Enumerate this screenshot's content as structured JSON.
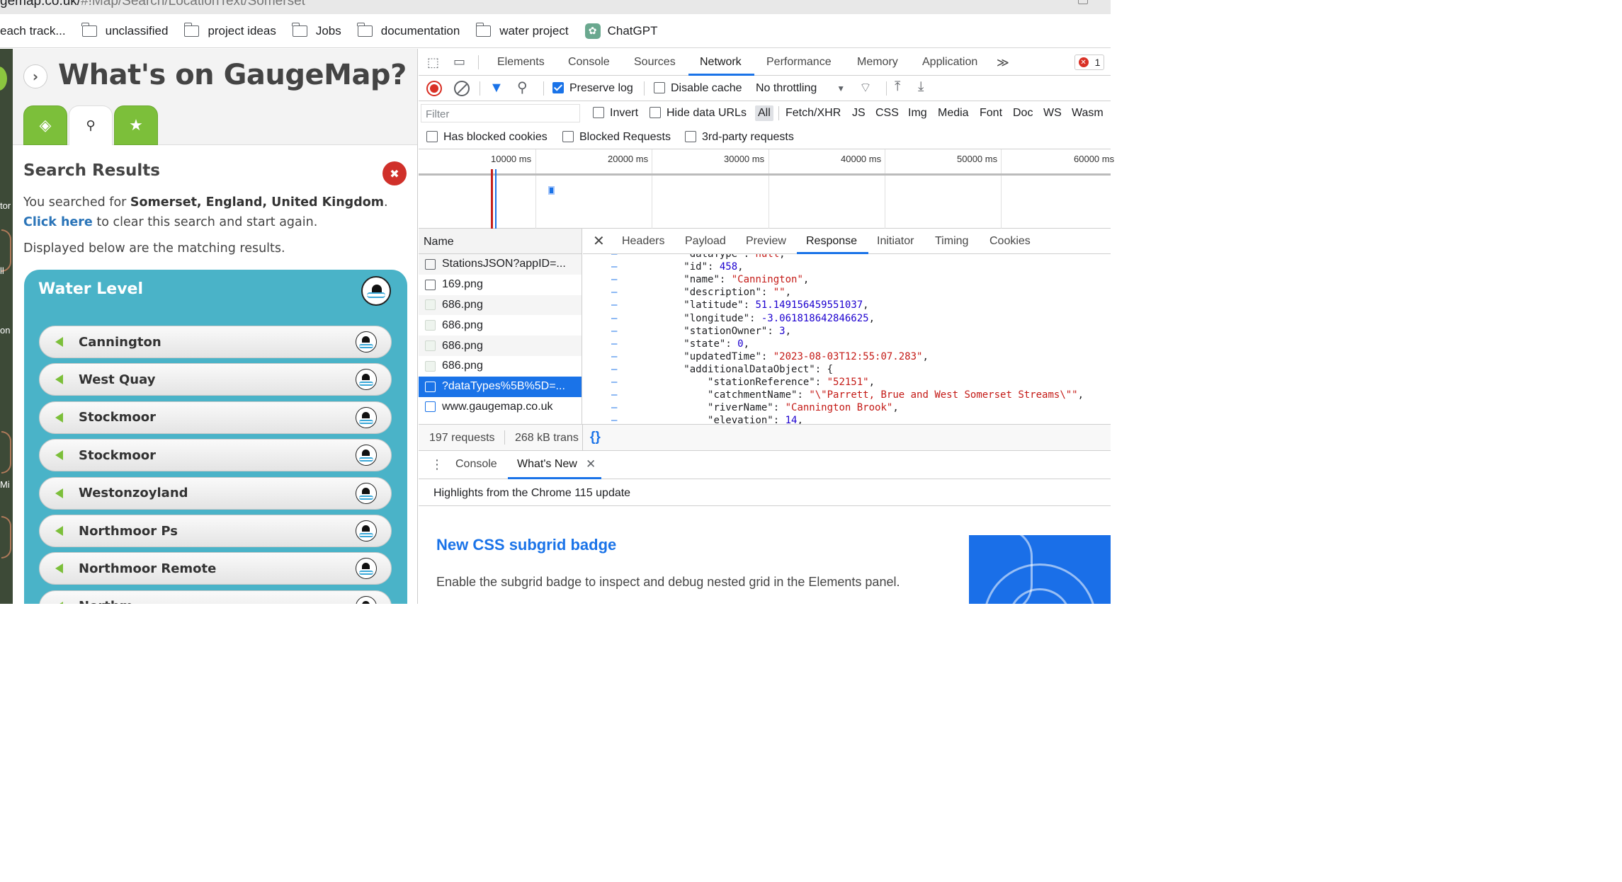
{
  "browser": {
    "url_prefix": "gemap.co.uk/",
    "url_path": "#!Map/Search/LocationText/Somerset"
  },
  "bookmarks": [
    "each track...",
    "unclassified",
    "project ideas",
    "Jobs",
    "documentation",
    "water project",
    "ChatGPT"
  ],
  "gaugemap": {
    "title": "What's on GaugeMap?",
    "search_results_title": "Search Results",
    "searched_for_prefix": "You searched for ",
    "searched_for_value": "Somerset, England, United Kingdom",
    "searched_for_suffix": ". ",
    "click_here": "Click here",
    "clear_text": " to clear this search and start again.",
    "matching_text": "Displayed below are the matching results.",
    "section_title": "Water Level",
    "stations": [
      "Cannington",
      "West Quay",
      "Stockmoor",
      "Stockmoor",
      "Westonzoyland",
      "Northmoor Ps",
      "Northmoor Remote",
      "Northm"
    ]
  },
  "map_labels": [
    "tor",
    "ll",
    "on",
    "Mi"
  ],
  "devtools": {
    "tabs": [
      "Elements",
      "Console",
      "Sources",
      "Network",
      "Performance",
      "Memory",
      "Application"
    ],
    "active_tab": "Network",
    "error_count": "1",
    "toolbar": {
      "preserve_log": "Preserve log",
      "disable_cache": "Disable cache",
      "throttling": "No throttling"
    },
    "filter": {
      "placeholder": "Filter",
      "invert": "Invert",
      "hide_data_urls": "Hide data URLs",
      "types": [
        "All",
        "Fetch/XHR",
        "JS",
        "CSS",
        "Img",
        "Media",
        "Font",
        "Doc",
        "WS",
        "Wasm"
      ],
      "has_blocked_cookies": "Has blocked cookies",
      "blocked_requests": "Blocked Requests",
      "third_party": "3rd-party requests"
    },
    "timeline_labels": [
      "10000 ms",
      "20000 ms",
      "30000 ms",
      "40000 ms",
      "50000 ms",
      "60000 ms"
    ],
    "requests_header": "Name",
    "requests": [
      {
        "name": "StationsJSON?appID=...",
        "kind": "xhr"
      },
      {
        "name": "169.png",
        "kind": "xhr"
      },
      {
        "name": "686.png",
        "kind": "img"
      },
      {
        "name": "686.png",
        "kind": "img"
      },
      {
        "name": "686.png",
        "kind": "img"
      },
      {
        "name": "686.png",
        "kind": "img"
      },
      {
        "name": "?dataTypes%5B%5D=...",
        "kind": "xhr",
        "selected": true
      },
      {
        "name": "www.gaugemap.co.uk",
        "kind": "doc"
      }
    ],
    "detail_tabs": [
      "Headers",
      "Payload",
      "Preview",
      "Response",
      "Initiator",
      "Timing",
      "Cookies"
    ],
    "active_detail_tab": "Response",
    "response_lines": [
      {
        "indent": 1,
        "key": "\"dataType\"",
        "value": "null",
        "vtype": "s",
        "comma": true
      },
      {
        "indent": 1,
        "key": "\"id\"",
        "value": "458",
        "vtype": "n",
        "comma": true
      },
      {
        "indent": 1,
        "key": "\"name\"",
        "value": "\"Cannington\"",
        "vtype": "s",
        "comma": true
      },
      {
        "indent": 1,
        "key": "\"description\"",
        "value": "\"\"",
        "vtype": "s",
        "comma": true
      },
      {
        "indent": 1,
        "key": "\"latitude\"",
        "value": "51.149156459551037",
        "vtype": "n",
        "comma": true
      },
      {
        "indent": 1,
        "key": "\"longitude\"",
        "value": "-3.061818642846625",
        "vtype": "n",
        "comma": true
      },
      {
        "indent": 1,
        "key": "\"stationOwner\"",
        "value": "3",
        "vtype": "n",
        "comma": true
      },
      {
        "indent": 1,
        "key": "\"state\"",
        "value": "0",
        "vtype": "n",
        "comma": true
      },
      {
        "indent": 1,
        "key": "\"updatedTime\"",
        "value": "\"2023-08-03T12:55:07.283\"",
        "vtype": "s",
        "comma": true
      },
      {
        "indent": 1,
        "key": "\"additionalDataObject\"",
        "value": "{",
        "vtype": "p",
        "comma": false
      },
      {
        "indent": 2,
        "key": "\"stationReference\"",
        "value": "\"52151\"",
        "vtype": "s",
        "comma": true
      },
      {
        "indent": 2,
        "key": "\"catchmentName\"",
        "value": "\"\\\"Parrett, Brue and West Somerset Streams\\\"\"",
        "vtype": "s",
        "comma": true
      },
      {
        "indent": 2,
        "key": "\"riverName\"",
        "value": "\"Cannington Brook\"",
        "vtype": "s",
        "comma": true
      },
      {
        "indent": 2,
        "key": "\"elevation\"",
        "value": "14",
        "vtype": "n",
        "comma": true
      }
    ],
    "footer": {
      "requests": "197 requests",
      "transferred": "268 kB trans"
    },
    "drawer_tabs": [
      "Console",
      "What's New"
    ],
    "whats_new": {
      "highlight": "Highlights from the Chrome 115 update",
      "heading": "New CSS subgrid badge",
      "body": "Enable the subgrid badge to inspect and debug nested grid in the Elements panel."
    }
  }
}
